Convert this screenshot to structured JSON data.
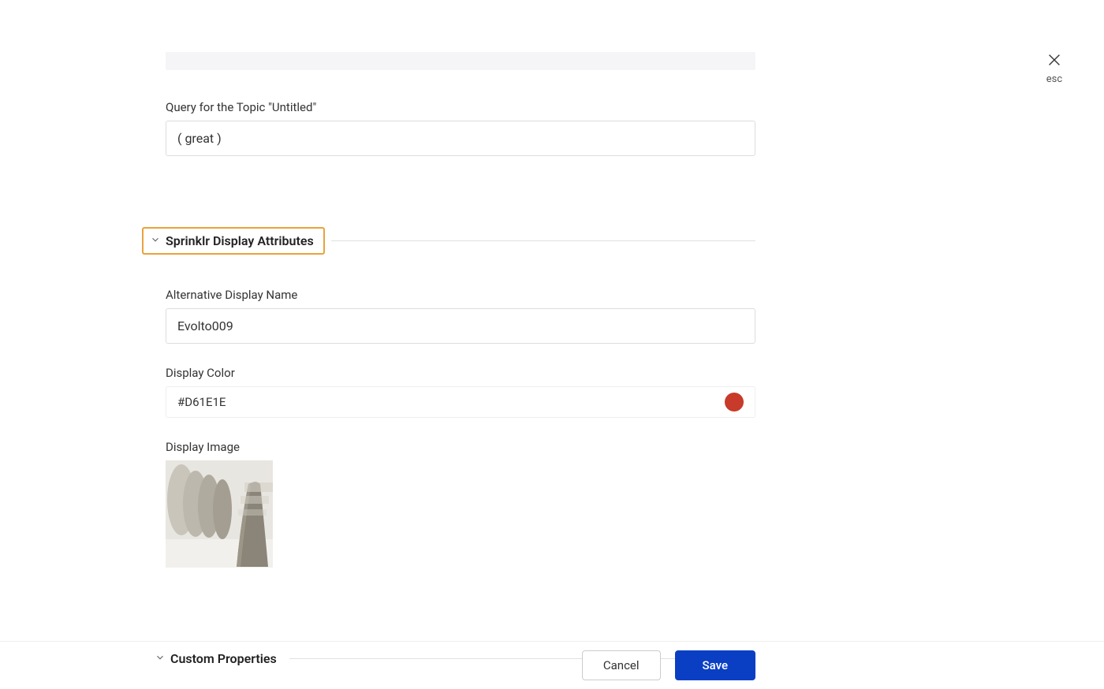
{
  "close": {
    "label": "esc"
  },
  "query": {
    "label": "Query for the Topic \"Untitled\"",
    "value": "( great )"
  },
  "sections": {
    "display_attributes": {
      "title": "Sprinklr Display Attributes",
      "fields": {
        "alt_name": {
          "label": "Alternative Display Name",
          "value": "Evolto009"
        },
        "display_color": {
          "label": "Display Color",
          "value": "#D61E1E",
          "swatch": "#c83a2a"
        },
        "display_image": {
          "label": "Display Image"
        }
      }
    },
    "custom_properties": {
      "title": "Custom Properties"
    }
  },
  "footer": {
    "cancel": "Cancel",
    "save": "Save"
  }
}
